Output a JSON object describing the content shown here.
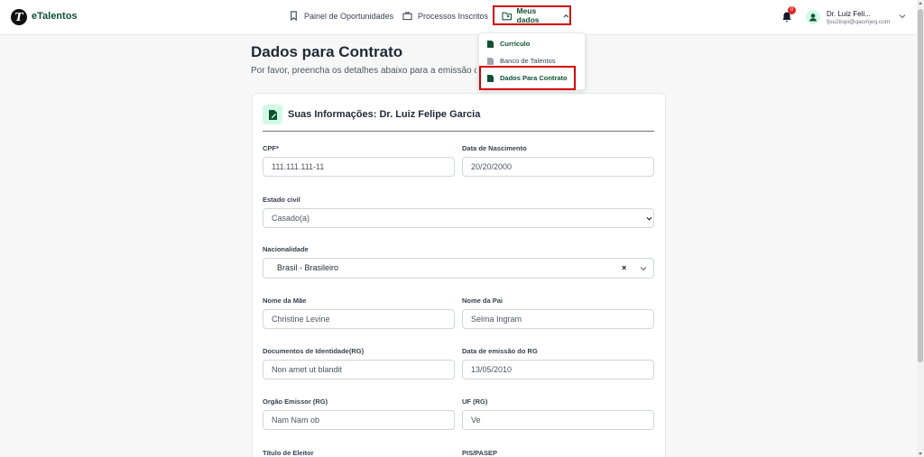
{
  "app": {
    "brand": "eTalentos",
    "logo_letter": "T"
  },
  "nav": {
    "items": [
      {
        "label": "Painel de Oportunidades",
        "icon": "bookmark-icon"
      },
      {
        "label": "Processos Inscritos",
        "icon": "briefcase-icon"
      }
    ],
    "active": {
      "label": "Meus dados",
      "icon": "folder-user-icon"
    }
  },
  "dropdown": {
    "items": [
      {
        "label": "Currículo",
        "icon": "document-icon"
      },
      {
        "label": "Banco de Talentos",
        "icon": "document-icon"
      },
      {
        "label": "Dados Para Contrato",
        "icon": "document-icon"
      }
    ]
  },
  "notifications": {
    "count": "0"
  },
  "user": {
    "name": "Dr. Luiz Feli...",
    "email": "fjsu2iispi@qacmjeq.com"
  },
  "page": {
    "title": "Dados para Contrato",
    "subtitle": "Por favor, preencha os detalhes abaixo para a emissão d"
  },
  "card": {
    "title": "Suas Informações: Dr. Luiz Felipe Garcia"
  },
  "fields": {
    "cpf": {
      "label": "CPF*",
      "value": "111.111.111-11"
    },
    "nascimento": {
      "label": "Data de Nascimento",
      "value": "20/20/2000"
    },
    "estado_civil": {
      "label": "Estado civil",
      "value": "Casado(a)"
    },
    "nacionalidade": {
      "label": "Nacionalidade",
      "value": "Brasil - Brasileiro",
      "clear": "×"
    },
    "nome_mae": {
      "label": "Nome da Mãe",
      "value": "Christine Levine"
    },
    "nome_pai": {
      "label": "Nome da Pai",
      "value": "Selma Ingram"
    },
    "rg": {
      "label": "Documentos de Identidade(RG)",
      "value": "Non amet ut blandit"
    },
    "rg_emissao": {
      "label": "Data de emissão do RG",
      "value": "13/05/2010"
    },
    "orgao_emissor": {
      "label": "Orgão Emissor (RG)",
      "value": "Nam Nam ob"
    },
    "uf_rg": {
      "label": "UF (RG)",
      "value": "Ve"
    },
    "titulo_eleitor": {
      "label": "Título de Eleitor"
    },
    "pis": {
      "label": "PIS/PASEP"
    }
  },
  "colors": {
    "brand_green": "#0f5132",
    "accent_red": "#d40000",
    "badge_red": "#dc2626"
  }
}
